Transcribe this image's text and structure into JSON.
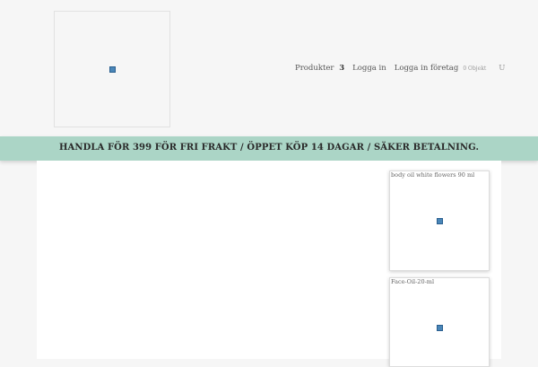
{
  "header": {
    "logo_alt": "logo"
  },
  "nav": {
    "products": "Produkter",
    "products_count": "3",
    "login": "Logga in",
    "login_company": "Logga in företag",
    "cart": "0 Objekt",
    "user": "U"
  },
  "banner": {
    "text": "HANDLA FÖR 399 FÖR FRI FRAKT / ÖPPET KÖP 14 DAGAR / SÄKER BETALNING."
  },
  "products": [
    {
      "title": "body oil white flowers 90 ml"
    },
    {
      "title": "Face-Oil-20-ml"
    }
  ]
}
